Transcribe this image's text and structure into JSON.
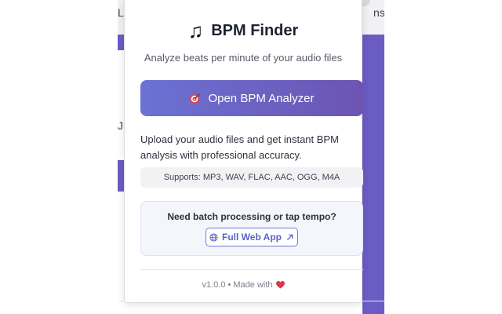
{
  "background": {
    "left_fragment": "L",
    "left_fragment_2": "J",
    "right_fragment": "ns",
    "accent_color": "#6b5cc3"
  },
  "popup": {
    "title": "BPM Finder",
    "title_icon": "music-notes-icon",
    "subtitle": "Analyze beats per minute of your audio files",
    "primary_button": {
      "label": "Open BPM Analyzer",
      "icon": "target-icon",
      "gradient": [
        "#6a72d4",
        "#6d54b2"
      ]
    },
    "description": "Upload your audio files and get instant BPM analysis with professional accuracy.",
    "formats": "Supports: MP3, WAV, FLAC, AAC, OGG, M4A",
    "promo": {
      "text": "Need batch processing or tap tempo?",
      "link_label": "Full Web App",
      "link_icon": "globe-icon",
      "link_trailing_icon": "external-arrow-icon",
      "accent_color": "#5c63c9"
    },
    "footer": {
      "version": "v1.0.0 • Made with",
      "heart_icon": "heart-icon",
      "heart_color": "#d63a4a"
    }
  }
}
